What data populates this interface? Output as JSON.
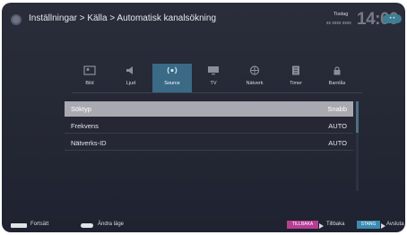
{
  "header": {
    "breadcrumb": "Inställningar > Källa > Automatisk kanalsökning",
    "day": "Tisdag",
    "date": "xx xxxx xxxx",
    "clock": "14:00"
  },
  "tabs": [
    {
      "label": "Bild",
      "icon": "picture-icon"
    },
    {
      "label": "Ljud",
      "icon": "speaker-icon"
    },
    {
      "label": "Source",
      "icon": "antenna-icon",
      "active": true
    },
    {
      "label": "TV",
      "icon": "tv-icon"
    },
    {
      "label": "Nätverk",
      "icon": "network-icon"
    },
    {
      "label": "Timer",
      "icon": "timer-icon"
    },
    {
      "label": "Barnlås",
      "icon": "lock-icon"
    }
  ],
  "menu": {
    "rows": [
      {
        "label": "Söktyp",
        "value": "Snabb",
        "selected": true
      },
      {
        "label": "Frekvens",
        "value": "AUTO"
      },
      {
        "label": "Nätverks-ID",
        "value": "AUTO"
      }
    ]
  },
  "footer": {
    "continue": "Fortsätt",
    "change_mode": "Ändra läge",
    "back_key": "TILLBAKA",
    "back": "Tillbaka",
    "stop_key": "STANG",
    "exit": "Avsluta"
  },
  "colors": {
    "active_tab": "#3a6a86",
    "selected_row": "#a9a9b2",
    "back_key": "#b73d93",
    "stop_key": "#3b8bb0"
  }
}
